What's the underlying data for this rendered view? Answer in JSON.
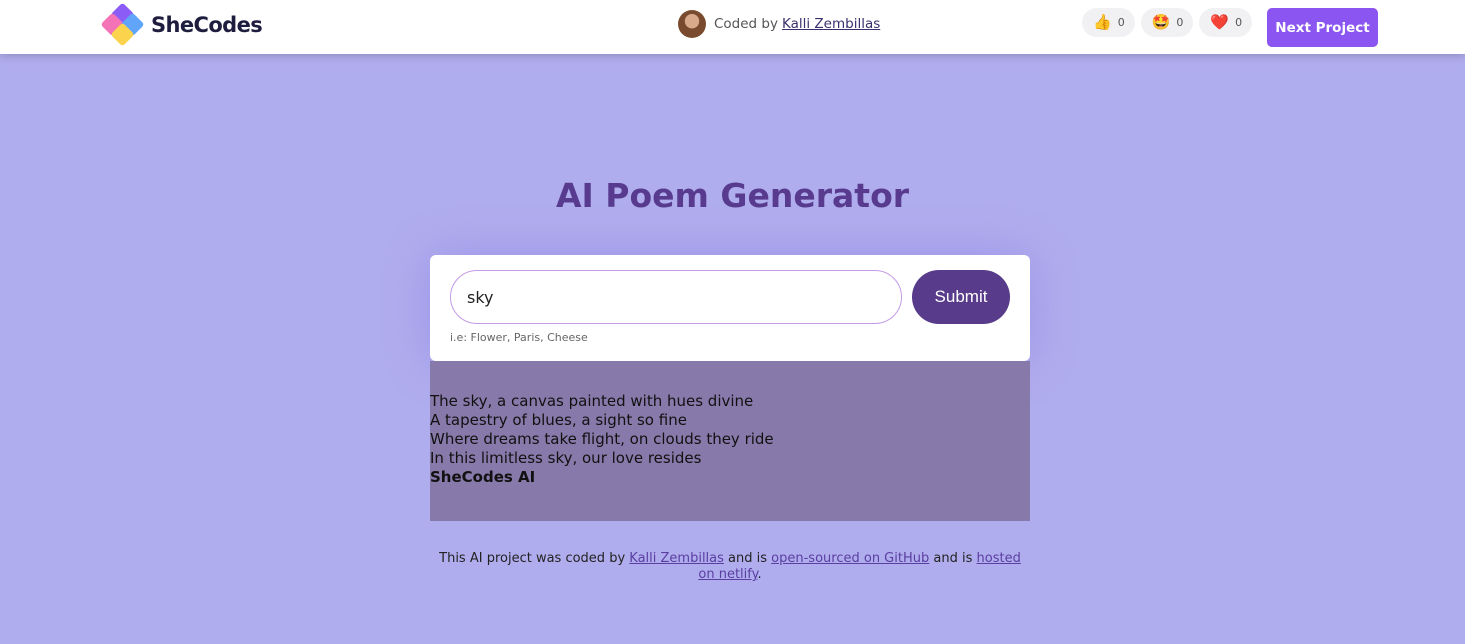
{
  "header": {
    "brand": "SheCodes",
    "coded_by_prefix": "Coded by",
    "author": "Kalli Zembillas",
    "reactions": [
      {
        "icon": "thumbs-up-icon",
        "glyph": "👍",
        "count": "0"
      },
      {
        "icon": "star-struck-icon",
        "glyph": "🤩",
        "count": "0"
      },
      {
        "icon": "heart-icon",
        "glyph": "❤️",
        "count": "0"
      }
    ],
    "next_label": "Next Project"
  },
  "main": {
    "title": "AI Poem Generator",
    "input_value": "sky",
    "submit_label": "Submit",
    "hint": "i.e: Flower, Paris, Cheese",
    "poem": {
      "lines": [
        "The sky, a canvas painted with hues divine",
        "A tapestry of blues, a sight so fine",
        "Where dreams take flight, on clouds they ride",
        "In this limitless sky, our love resides"
      ],
      "signature": "SheCodes AI"
    }
  },
  "footer": {
    "text1": "This AI project was coded by",
    "author": "Kalli Zembillas",
    "text2": "and is",
    "github": "open-sourced on GitHub",
    "text3": "and is",
    "hosted": "hosted on netlify",
    "end": "."
  },
  "colors": {
    "background": "#b0adee",
    "title": "#583b8f",
    "submit": "#583b8a",
    "next_button": "#8a55f0",
    "poem_box": "#8779aa"
  }
}
